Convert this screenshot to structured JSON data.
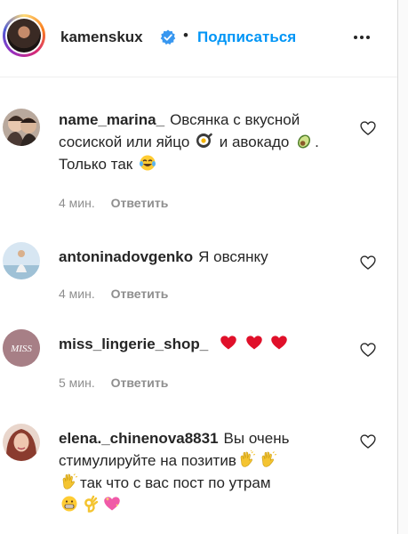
{
  "header": {
    "username": "kamenskux",
    "separator": "•",
    "follow_label": "Подписаться"
  },
  "comments": [
    {
      "username": "name_marina_",
      "text_parts": [
        "Овсянка с вкусной сосиской или яйцо",
        "и авокадо",
        ". Только так"
      ],
      "time": "4 мин.",
      "reply_label": "Ответить"
    },
    {
      "username": "antoninadovgenko",
      "text_parts": [
        "Я овсянку"
      ],
      "time": "4 мин.",
      "reply_label": "Ответить"
    },
    {
      "username": "miss_lingerie_shop_",
      "text_parts": [
        ""
      ],
      "avatar_text": "MISS",
      "time": "5 мин.",
      "reply_label": "Ответить"
    },
    {
      "username": "elena._chinenova8831",
      "text_parts": [
        "Вы очень стимулируйте на позитив",
        "так что с вас пост по утрам"
      ]
    }
  ],
  "colors": {
    "accent": "#0095f6",
    "muted": "#8e8e8e",
    "text": "#262626",
    "verified": "#3897f0",
    "heart_emoji": "#e0102a"
  },
  "icons": {
    "verified": "verified-badge-icon",
    "more": "more-options-icon",
    "like": "heart-outline-icon"
  }
}
